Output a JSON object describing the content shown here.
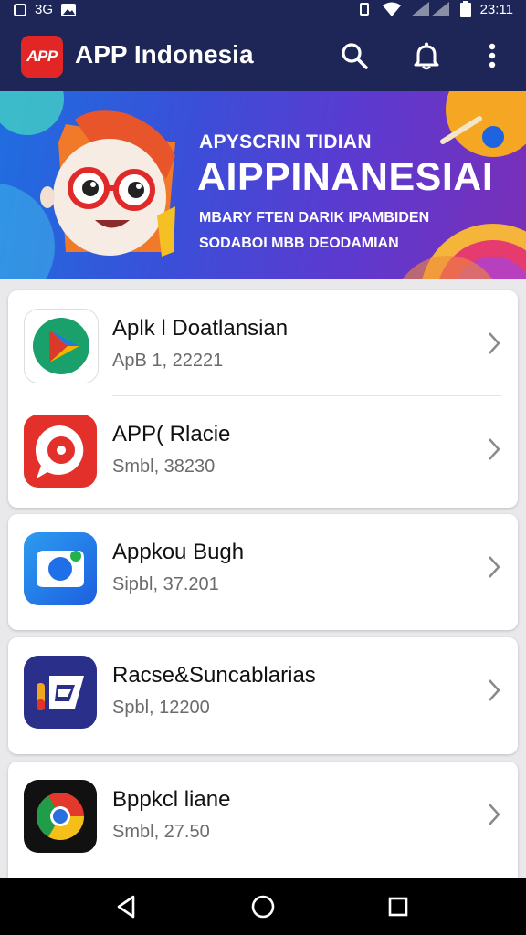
{
  "status_bar": {
    "left_text": "3G",
    "time": "23:11",
    "icons": [
      "notification-icon",
      "image-icon",
      "vibrate-icon",
      "wifi-icon",
      "signal-icon",
      "battery-icon"
    ]
  },
  "header": {
    "logo_text": "APP",
    "title": "APP Indonesia",
    "actions": [
      "search-icon",
      "bell-icon",
      "more-vert-icon"
    ]
  },
  "banner": {
    "line1": "APYSCRIN TIDIAN",
    "line2": "AIPPINANESIAI",
    "line3": "MBARY FTEN DARIK IPAMBIDEN",
    "line4": "SODABOI MBB DEODAMIAN"
  },
  "apps": [
    {
      "name": "Aplk  l Doatlansian",
      "subtitle": "ApB 1, 22221",
      "icon": "play-store-icon"
    },
    {
      "name": "APP( Rlacie",
      "subtitle": "Smbl, 38230",
      "icon": "chat-bubble-icon"
    },
    {
      "name": "Appkou Bugh",
      "subtitle": "Sipbl, 37.201",
      "icon": "camera-icon"
    },
    {
      "name": "Racse&Suncablarias",
      "subtitle": "Spbl, 12200",
      "icon": "mail-icon"
    },
    {
      "name": "Bppkcl liane",
      "subtitle": "Smbl, 27.50",
      "icon": "chrome-icon"
    }
  ],
  "nav": [
    "back-icon",
    "home-icon",
    "recents-icon"
  ],
  "colors": {
    "header_bg": "#1d2656",
    "logo_red": "#e22626",
    "page_bg": "#e9e9ec"
  }
}
